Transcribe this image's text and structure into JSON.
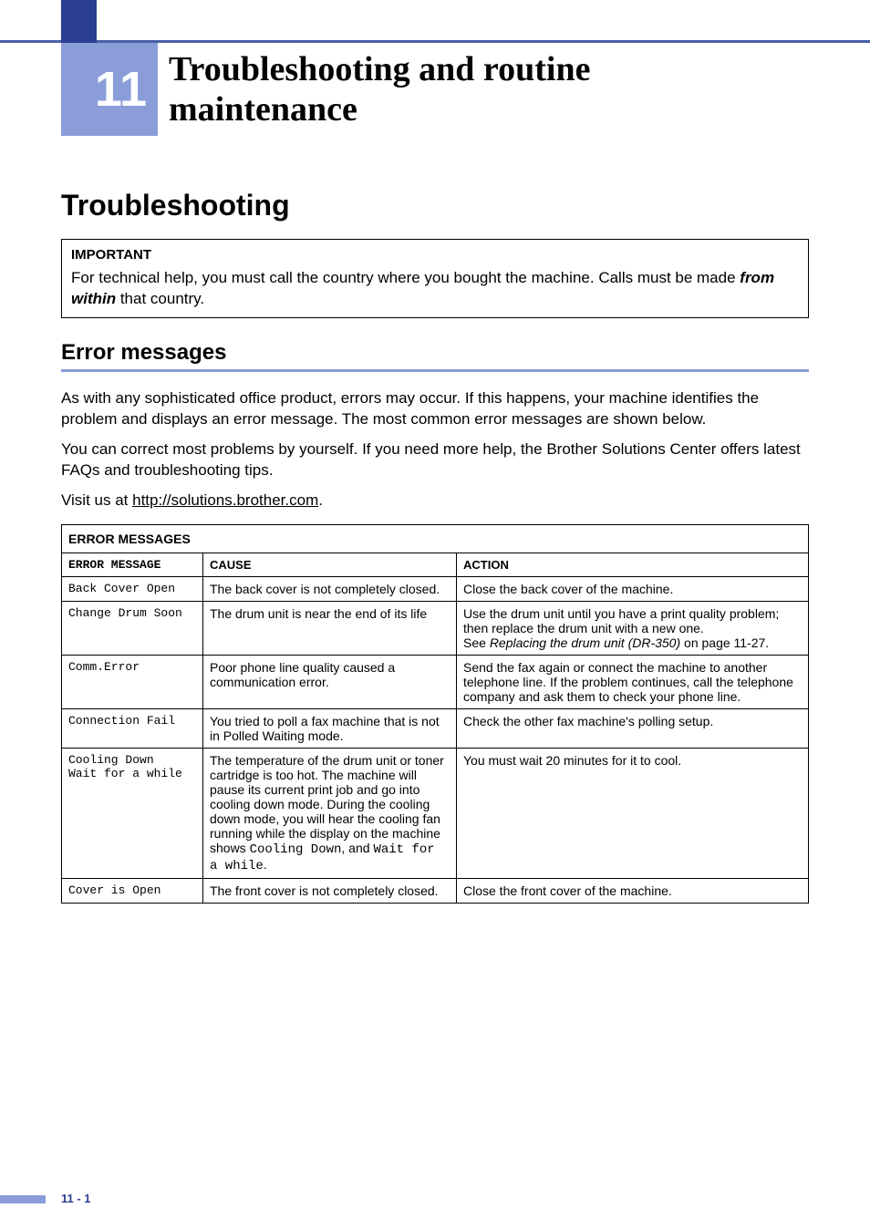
{
  "chapter": {
    "number": "11",
    "title_line1": "Troubleshooting and routine",
    "title_line2": "maintenance"
  },
  "section_h1": "Troubleshooting",
  "important": {
    "label": "IMPORTANT",
    "text_part1": "For technical help, you must call the country where you bought the machine. Calls must be made ",
    "text_bold": "from within",
    "text_part2": " that country."
  },
  "section_h2": "Error messages",
  "para1": "As with any sophisticated office product, errors may occur. If this happens, your machine identifies the problem and displays an error message. The most common error messages are shown below.",
  "para2": "You can correct most problems by yourself. If you need more help, the Brother Solutions Center offers latest FAQs and troubleshooting tips.",
  "para3_prefix": "Visit us at ",
  "para3_link": "http://solutions.brother.com",
  "para3_suffix": ".",
  "table": {
    "caption": "ERROR MESSAGES",
    "headers": {
      "message": "ERROR MESSAGE",
      "cause": "CAUSE",
      "action": "ACTION"
    },
    "rows": [
      {
        "message": "Back Cover Open",
        "cause": "The back cover is not completely closed.",
        "action": "Close the back cover of the machine."
      },
      {
        "message": "Change Drum Soon",
        "cause": "The drum unit is near the end of its life",
        "action_line1": "Use the drum unit until you have a print quality problem; then replace the drum unit with a new one.",
        "action_line2_prefix": "See ",
        "action_line2_italic": "Replacing the drum unit (DR-350)",
        "action_line2_suffix": " on page 11-27."
      },
      {
        "message": "Comm.Error",
        "cause": "Poor phone line quality caused a communication error.",
        "action": "Send the fax again or connect the machine to another telephone line. If the problem continues, call the telephone company and ask them to check your phone line."
      },
      {
        "message": "Connection Fail",
        "cause": "You tried to poll a fax machine that is not in Polled Waiting mode.",
        "action": "Check the other fax machine's polling setup."
      },
      {
        "message_line1": "Cooling Down",
        "message_line2": "Wait for a while",
        "cause_part1": "The temperature of the drum unit or toner cartridge is too hot. The machine will pause its current print job and go into cooling down mode. During the cooling down mode, you will hear the cooling fan running while the display on the machine shows ",
        "cause_mono1": "Cooling Down",
        "cause_part2": ", and ",
        "cause_mono2": "Wait for a while",
        "cause_part3": ".",
        "action": "You must wait 20 minutes for it to cool."
      },
      {
        "message": "Cover is Open",
        "cause": "The front cover is not completely closed.",
        "action": "Close the front cover of the machine."
      }
    ]
  },
  "page_number": "11 - 1"
}
